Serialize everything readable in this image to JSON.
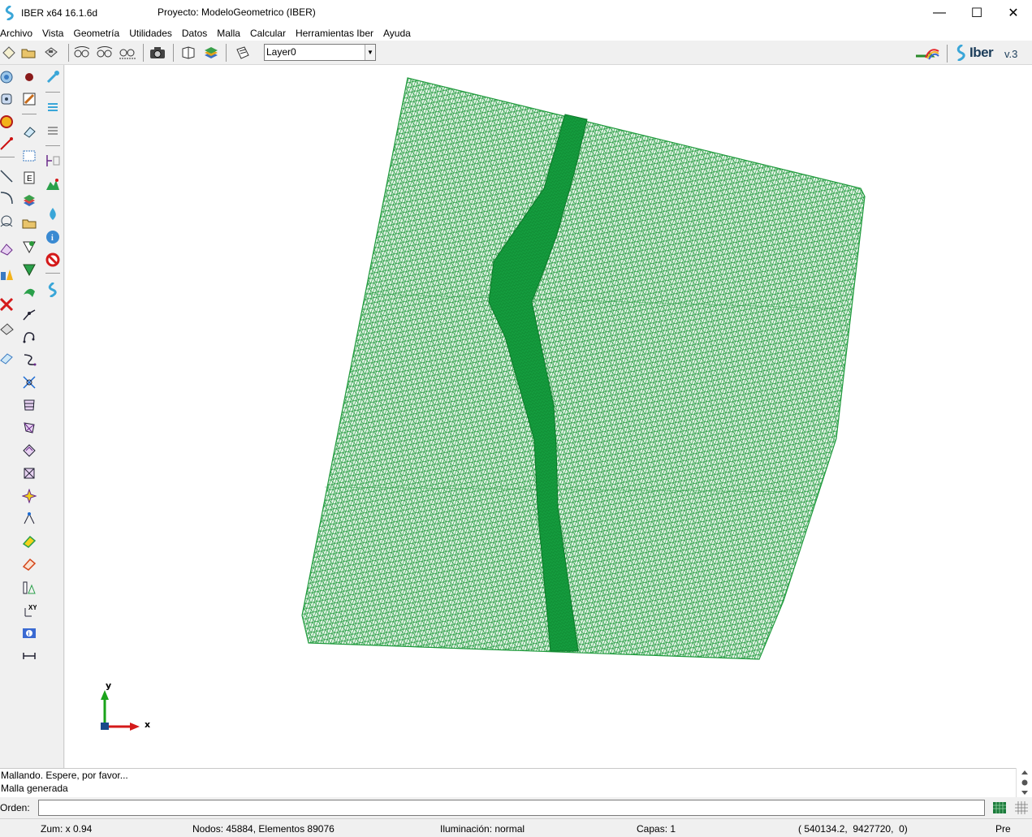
{
  "window": {
    "app_title": "IBER x64 16.1.6d",
    "document_title": "Proyecto: ModeloGeometrico (IBER)",
    "minimize": "—",
    "maximize": "☐",
    "close": "✕"
  },
  "menu": [
    "Archivo",
    "Vista",
    "Geometría",
    "Utilidades",
    "Datos",
    "Malla",
    "Calcular",
    "Herramientas Iber",
    "Ayuda"
  ],
  "toolbar": {
    "layer_value": "Layer0",
    "brand_name": "Iber",
    "brand_version": "v.3"
  },
  "axes": {
    "y_label": "y",
    "x_label": "x"
  },
  "messages": [
    "Mallando. Espere, por favor...",
    "Malla generada"
  ],
  "command": {
    "label": "Orden:",
    "value": ""
  },
  "status": {
    "zoom": "Zum: x 0.94",
    "mesh_info": "Nodos: 45884, Elementos 89076",
    "lighting": "Iluminación: normal",
    "layers": "Capas: 1",
    "coords": "( 540134.2,  9427720,  0)",
    "mode": "Pre"
  },
  "colors": {
    "mesh_stroke": "#1f9a3c",
    "mesh_fill": "#e9f5eb",
    "channel_fill": "#15a040",
    "axis_y": "#1aa31a",
    "axis_x": "#d41a1a"
  }
}
